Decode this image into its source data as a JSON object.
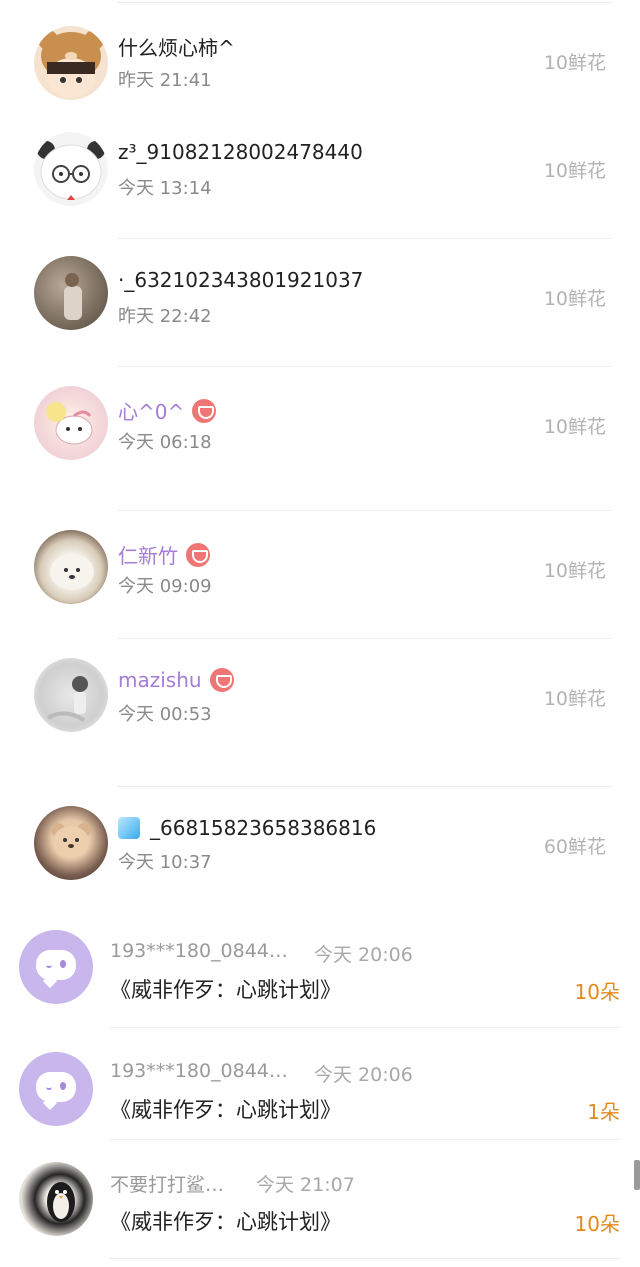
{
  "flower_list": [
    {
      "name": "什么烦心柿^",
      "time": "昨天 21:41",
      "flowers": "10鲜花",
      "vip": false,
      "avatar": "bear-hat-girl-avatar"
    },
    {
      "name": "z³_91082128002478440",
      "time": "今天 13:14",
      "flowers": "10鲜花",
      "vip": false,
      "avatar": "panda-glasses-avatar"
    },
    {
      "name": "·_632102343801921037",
      "time": "昨天 22:42",
      "flowers": "10鲜花",
      "vip": false,
      "avatar": "photo-avatar"
    },
    {
      "name": "心^0^",
      "time": "今天 06:18",
      "flowers": "10鲜花",
      "vip": true,
      "avatar": "sticker-avatar"
    },
    {
      "name": "仁新竹",
      "time": "今天 09:09",
      "flowers": "10鲜花",
      "vip": true,
      "avatar": "dog-avatar"
    },
    {
      "name": "mazishu",
      "time": "今天 00:53",
      "flowers": "10鲜花",
      "vip": true,
      "avatar": "bw-photo-avatar"
    },
    {
      "name": "_66815823658386816",
      "time": "今天 10:37",
      "flowers": "60鲜花",
      "vip": false,
      "avatar": "teddy-avatar",
      "prefix_icon": "ice-cube-icon"
    }
  ],
  "gift_list": [
    {
      "user": "193***180_0844…",
      "time": "今天 20:06",
      "book": "《威非作歹：心跳计划》",
      "count": "10朵",
      "avatar": "chat-bubble-avatar"
    },
    {
      "user": "193***180_0844…",
      "time": "今天 20:06",
      "book": "《威非作歹：心跳计划》",
      "count": "1朵",
      "avatar": "chat-bubble-avatar"
    },
    {
      "user": "不要打打鲨…",
      "time": "今天 21:07",
      "book": "《威非作歹：心跳计划》",
      "count": "10朵",
      "avatar": "penguin-avatar"
    }
  ],
  "colors": {
    "vip_name": "#a57cd6",
    "flower_count": "#b3b3b3",
    "gift_count": "#e4891f",
    "vip_badge": "#f07575"
  }
}
